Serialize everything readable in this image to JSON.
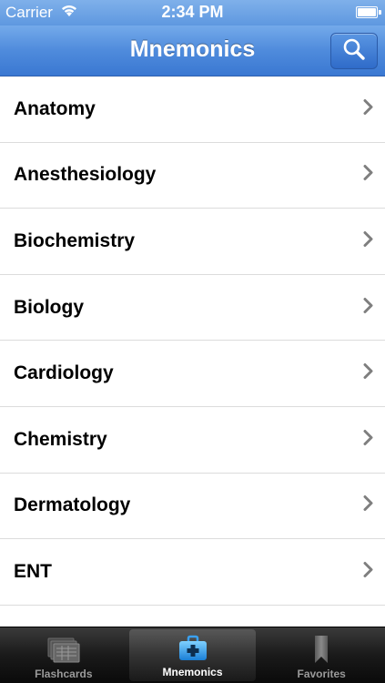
{
  "status_bar": {
    "carrier": "Carrier",
    "time": "2:34 PM"
  },
  "nav": {
    "title": "Mnemonics",
    "search_icon": "magnifier-icon"
  },
  "list": {
    "items": [
      {
        "label": "Anatomy"
      },
      {
        "label": "Anesthesiology"
      },
      {
        "label": "Biochemistry"
      },
      {
        "label": "Biology"
      },
      {
        "label": "Cardiology"
      },
      {
        "label": "Chemistry"
      },
      {
        "label": "Dermatology"
      },
      {
        "label": "ENT"
      }
    ]
  },
  "tab_bar": {
    "tabs": [
      {
        "label": "Flashcards",
        "icon": "flashcards-icon",
        "selected": false
      },
      {
        "label": "Mnemonics",
        "icon": "medical-kit-icon",
        "selected": true
      },
      {
        "label": "Favorites",
        "icon": "bookmark-icon",
        "selected": false
      }
    ]
  },
  "colors": {
    "nav_blue": "#4f8bdc",
    "tab_dark": "#1a1a1a",
    "selected_icon": "#3aa0ef"
  }
}
